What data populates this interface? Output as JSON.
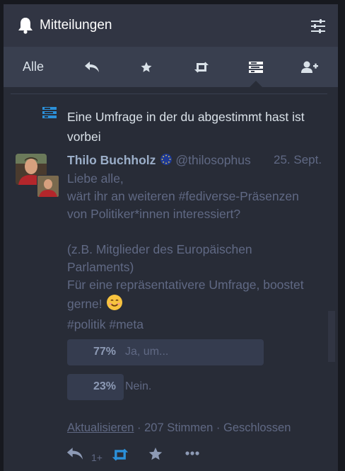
{
  "header": {
    "title": "Mitteilungen",
    "icon": "bell-icon",
    "settings_icon": "sliders-icon"
  },
  "tabs": [
    {
      "label": "Alle"
    },
    {
      "icon": "reply-icon"
    },
    {
      "icon": "star-icon"
    },
    {
      "icon": "boost-icon"
    },
    {
      "icon": "poll-icon",
      "active": true
    },
    {
      "icon": "follow-icon"
    }
  ],
  "notification": {
    "text": "Eine Umfrage in der du abgestimmt hast ist vorbei",
    "icon": "poll-icon"
  },
  "status": {
    "display_name": "Thilo Buchholz",
    "handle": "@thilosophus",
    "date": "25. Sept.",
    "lines": [
      "Liebe alle,",
      "wärt ihr an weiteren #fediverse-Präsenzen",
      "von Politiker*innen interessiert?"
    ],
    "lines2": [
      "(z.B. Mitglieder des Europäischen",
      "Parlaments)",
      "Für eine repräsentativere Umfrage, boostet"
    ],
    "last_line": "gerne!",
    "hashtag1": "#politik",
    "hashtag2": "#meta"
  },
  "poll": {
    "options": [
      {
        "percent": "77%",
        "label": "Ja, um...",
        "value": 77
      },
      {
        "percent": "23%",
        "label": "Nein.",
        "value": 23
      }
    ],
    "refresh_label": "Aktualisieren",
    "meta": " · 207 Stimmen · Geschlossen"
  },
  "actions": {
    "reply_count": "1+"
  },
  "colors": {
    "accent": "#2b90d9",
    "muted": "#606984",
    "text": "#d9e1e8"
  }
}
